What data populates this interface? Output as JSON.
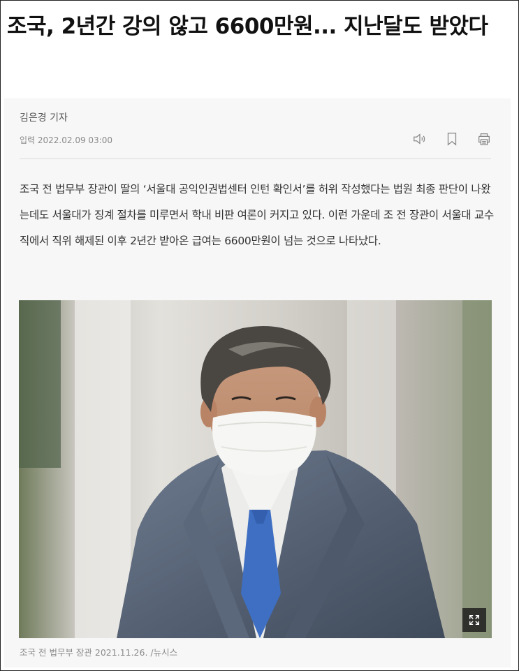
{
  "article": {
    "headline": "조국, 2년간 강의 않고 6600만원... 지난달도 받았다",
    "byline": "김은경 기자",
    "date": "입력 2022.02.09 03:00",
    "body": "조국 전 법무부 장관이 딸의 ‘서울대 공익인권법센터 인턴 확인서’를 허위 작성했다는 법원 최종 판단이 나왔는데도 서울대가 징계 절차를 미루면서 학내 비판 여론이 커지고 있다. 이런 가운데 조 전 장관이 서울대 교수직에서 직위 해제된 이후 2년간 받아온 급여는 6600만원이 넘는 것으로 나타났다.",
    "photo_caption": "조국 전 법무부 장관 2021.11.26. /뉴시스"
  },
  "tools": {
    "listen_icon": "speaker-icon",
    "bookmark_icon": "bookmark-icon",
    "print_icon": "print-icon"
  },
  "photo": {
    "expand_icon": "expand-icon"
  },
  "colors": {
    "article_bg": "#f7f7f7",
    "meta_text": "#8a8a8a",
    "body_text": "#333333"
  }
}
